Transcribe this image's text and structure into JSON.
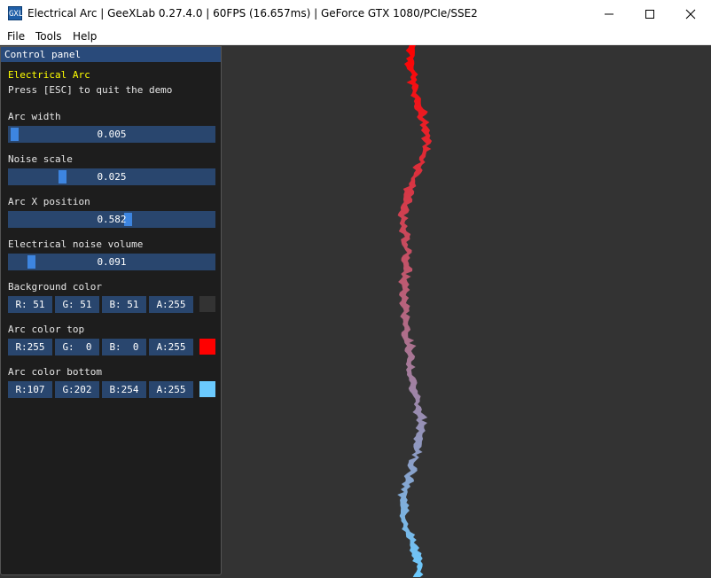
{
  "window": {
    "title": "Electrical Arc | GeeXLab 0.27.4.0 | 60FPS (16.657ms) | GeForce GTX 1080/PCIe/SSE2",
    "app_icon_label": "GXL"
  },
  "menubar": {
    "file": "File",
    "tools": "Tools",
    "help": "Help"
  },
  "panel": {
    "header": "Control panel",
    "demo_title": "Electrical Arc",
    "demo_hint": "Press [ESC] to quit the demo",
    "sliders": [
      {
        "label": "Arc width",
        "value": "0.005",
        "fraction": 0.005
      },
      {
        "label": "Noise scale",
        "value": "0.025",
        "fraction": 0.25
      },
      {
        "label": "Arc X position",
        "value": "0.582",
        "fraction": 0.582
      },
      {
        "label": "Electrical noise volume",
        "value": "0.091",
        "fraction": 0.091
      }
    ],
    "colors": [
      {
        "label": "Background color",
        "r": "R: 51",
        "g": "G: 51",
        "b": "B: 51",
        "a": "A:255",
        "swatch": "#333333"
      },
      {
        "label": "Arc color top",
        "r": "R:255",
        "g": "G:  0",
        "b": "B:  0",
        "a": "A:255",
        "swatch": "#ff0000"
      },
      {
        "label": "Arc color bottom",
        "r": "R:107",
        "g": "G:202",
        "b": "B:254",
        "a": "A:255",
        "swatch": "#6bcafe"
      }
    ]
  },
  "arc": {
    "x_position": 0.582,
    "color_top": "#ff0000",
    "color_bottom": "#6bcafe",
    "background": "#333333"
  }
}
